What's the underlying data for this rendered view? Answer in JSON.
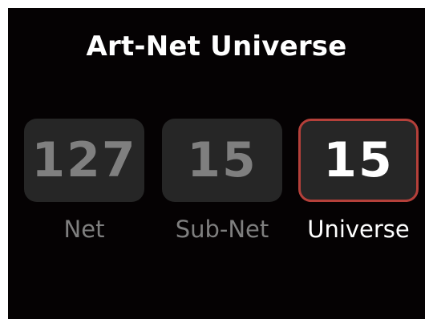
{
  "title": "Art-Net Universe",
  "fields": [
    {
      "value": "127",
      "label": "Net",
      "selected": false
    },
    {
      "value": "15",
      "label": "Sub-Net",
      "selected": false
    },
    {
      "value": "15",
      "label": "Universe",
      "selected": true
    }
  ],
  "colors": {
    "background": "#050203",
    "field_bg": "#262626",
    "inactive_text": "#7f7f7f",
    "active_text": "#ffffff",
    "selection_border": "#b5403a"
  }
}
